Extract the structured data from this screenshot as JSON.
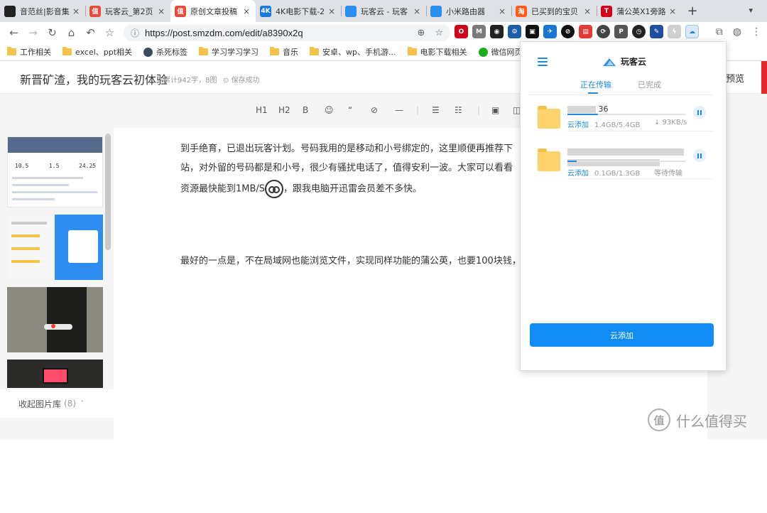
{
  "tabs": [
    {
      "title": "音范丝|影音集",
      "fav_color": "#222222",
      "fav_text": "",
      "active": false
    },
    {
      "title": "玩客云_第2页",
      "fav_color": "#e64c3c",
      "fav_text": "值",
      "active": false
    },
    {
      "title": "原创文章投稿",
      "fav_color": "#e64c3c",
      "fav_text": "值",
      "active": true
    },
    {
      "title": "4K电影下载-2",
      "fav_color": "#1a7ad9",
      "fav_text": "4K",
      "active": false
    },
    {
      "title": "玩客云 - 玩客",
      "fav_color": "#2e8ef0",
      "fav_text": "",
      "active": false
    },
    {
      "title": "小米路由器",
      "fav_color": "#2e8ef0",
      "fav_text": "",
      "active": false
    },
    {
      "title": "已买到的宝贝",
      "fav_color": "#ff5b1e",
      "fav_text": "淘",
      "active": false
    },
    {
      "title": "蒲公英X1旁路",
      "fav_color": "#d0021b",
      "fav_text": "T",
      "active": false
    }
  ],
  "address": {
    "url": "https://post.smzdm.com/edit/a8390x2q"
  },
  "bookmarks": [
    {
      "label": "工作相关",
      "type": "folder"
    },
    {
      "label": "excel、ppt相关",
      "type": "folder"
    },
    {
      "label": "杀死标签",
      "type": "site"
    },
    {
      "label": "学习学习学习",
      "type": "folder"
    },
    {
      "label": "音乐",
      "type": "folder"
    },
    {
      "label": "安卓、wp、手机游...",
      "type": "folder"
    },
    {
      "label": "电影下载相关",
      "type": "folder"
    },
    {
      "label": "微信网页版",
      "type": "site"
    }
  ],
  "editor": {
    "doc_title": "新晋矿渣，我的玩客云初体验",
    "meta": "累计942字，8图",
    "saved": "保存成功",
    "preview": "预览",
    "format_tools": [
      "H1",
      "H2",
      "B",
      "☺",
      "“",
      "⊘",
      "—",
      "|",
      "☰",
      "☷",
      "|",
      "▣",
      "◫"
    ]
  },
  "gallery": {
    "thumb1_nums": [
      "10.5",
      "1.5",
      "24.25"
    ],
    "footer_label": "收起图片库",
    "footer_count": "(8)"
  },
  "article": {
    "line1": "到手绝育，已退出玩客计划。号码我用的是移动和小号绑定的，这里顺便再推荐下",
    "line2": "站，对外留的号码都是和小号，很少有骚扰电话了，值得安利一波。大家可以看看",
    "line3_pre": "资源最快能到1MB/S",
    "line3_post": "，跟我电脑开迅雷会员差不多快。",
    "line4": "最好的一点是，不在局域网也能浏览文件，实现同样功能的蒲公英，也要100块钱，"
  },
  "watermark": {
    "logo_text": "值",
    "text": "什么值得买"
  },
  "popup": {
    "brand": "玩客云",
    "tab_active": "正在传输",
    "tab_inactive": "已完成",
    "items": [
      {
        "name_tail": "36",
        "action": "云添加",
        "size": "1.4GB/5.4GB",
        "speed": "↓ 93KB/s",
        "progress": 0.26
      },
      {
        "name_tail": "",
        "action": "云添加",
        "size": "0.1GB/1.3GB",
        "speed": "等待传输",
        "progress": 0.08
      }
    ],
    "add_button": "云添加",
    "accent": "#1a8ae5"
  }
}
